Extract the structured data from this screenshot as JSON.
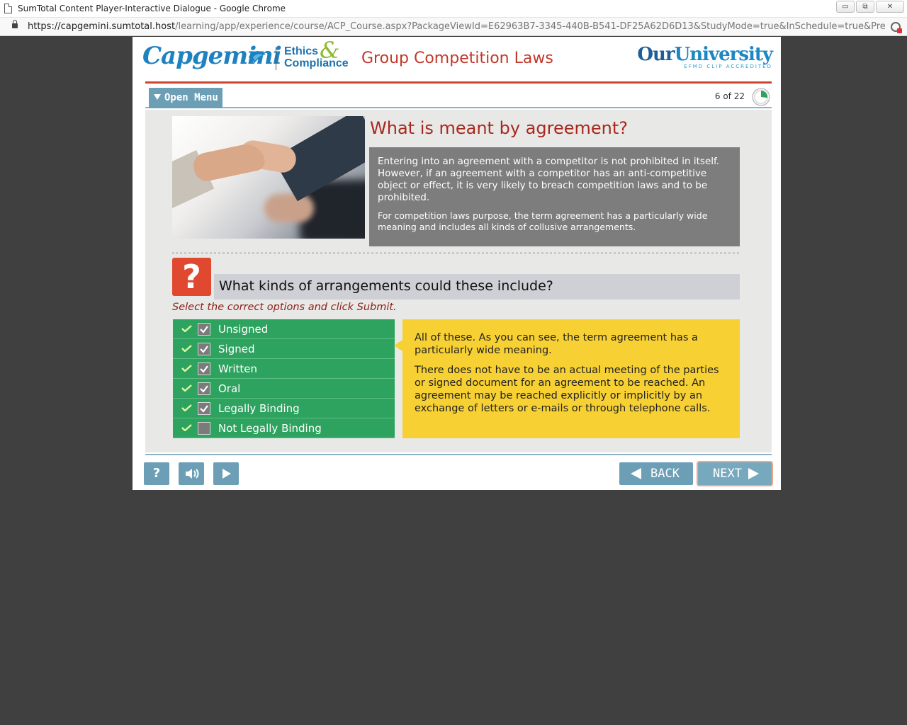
{
  "window": {
    "title": "SumTotal Content Player-Interactive Dialogue - Google Chrome",
    "url_host": "https://capgemini.sumtotal.host",
    "url_rest": "/learning/app/experience/course/ACP_Course.aspx?PackageViewId=E62963B7-3345-440B-B541-DF25A62D6D13&StudyMode=true&InSchedule=true&Preview=...",
    "buttons": {
      "minimize": "▭",
      "restore": "⧉",
      "close": "✕"
    }
  },
  "header": {
    "logo_capgemini": "Capgemini",
    "ethics_line1": "Ethics",
    "ethics_amp": "&",
    "ethics_line2": "Compliance",
    "course_title": "Group Competition Laws",
    "university_our": "Our",
    "university_name": "University",
    "university_accredited": "EFMD CLIP ACCREDITED"
  },
  "menu": {
    "open_menu_label": "Open Menu",
    "page_count": "6 of 22",
    "progress_fraction": 0.27
  },
  "content": {
    "heading": "What is meant by agreement?",
    "info_paragraph_1": "Entering into an agreement with a competitor is not prohibited in itself. However, if an agreement with a competitor has an anti-competitive object or effect, it is very likely to breach competition laws and to be prohibited.",
    "info_paragraph_2": "For competition laws purpose, the term  agreement has a particularly wide meaning and includes all kinds of collusive arrangements.",
    "question_mark": "?",
    "question": "What kinds of arrangements could these include?",
    "instruction": "Select the correct options and click Submit.",
    "options": [
      {
        "label": "Unsigned",
        "checked": true
      },
      {
        "label": "Signed",
        "checked": true
      },
      {
        "label": "Written",
        "checked": true
      },
      {
        "label": "Oral",
        "checked": true
      },
      {
        "label": "Legally Binding",
        "checked": true
      },
      {
        "label": "Not Legally Binding",
        "checked": false
      }
    ],
    "feedback_1": "All of these. As you can see, the term agreement has a particularly wide meaning.",
    "feedback_2": "There does not have to be an actual meeting of the parties or signed document for an agreement to be reached. An agreement may be reached explicitly or implicitly by an exchange of letters or e-mails or through telephone calls."
  },
  "nav": {
    "help_label": "?",
    "back_label": "BACK",
    "next_label": "NEXT"
  },
  "colors": {
    "accent_teal": "#6c9fb5",
    "option_green": "#2ea25f",
    "feedback_yellow": "#f7d033",
    "heading_red": "#a8281e"
  }
}
